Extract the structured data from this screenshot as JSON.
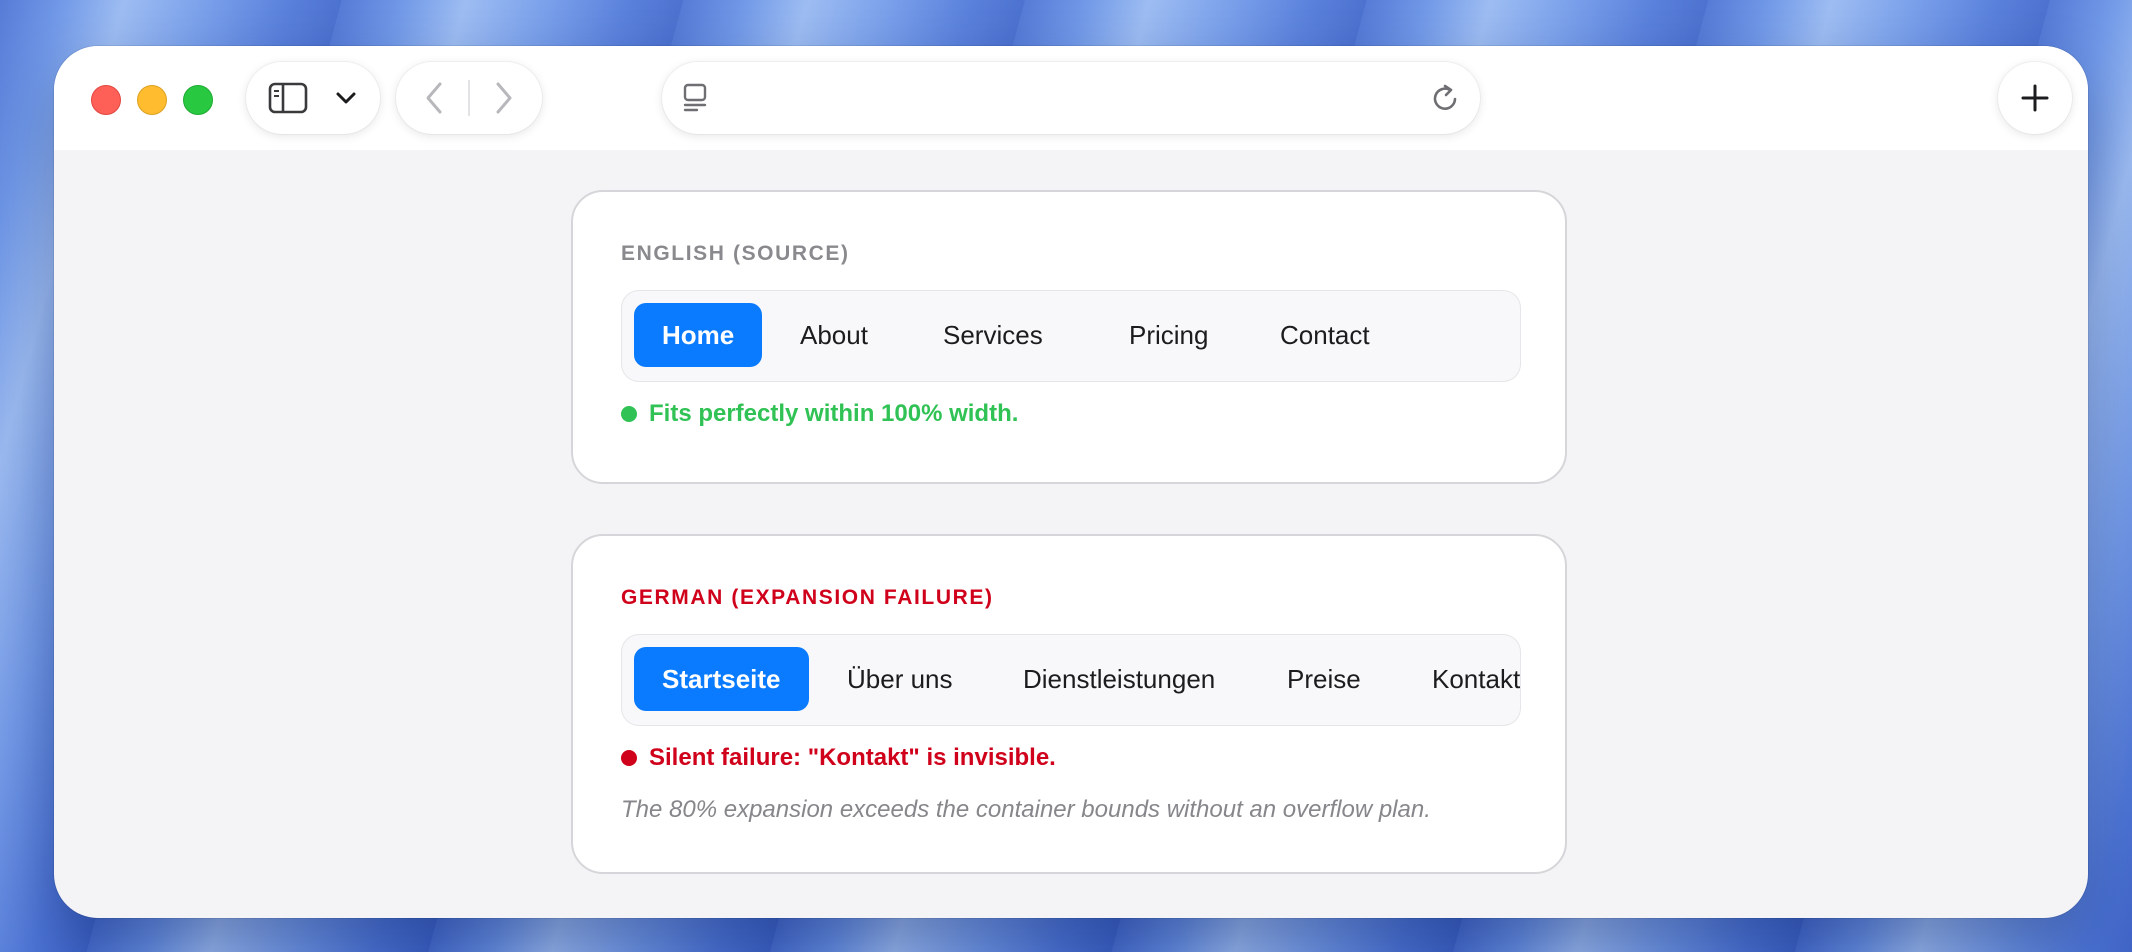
{
  "browser": {
    "address_text": "",
    "icons": {
      "sidebar": "sidebar-icon",
      "dropdown": "chevron-down-icon",
      "back": "chevron-left-icon",
      "forward": "chevron-right-icon",
      "reader": "reader-icon",
      "reload": "reload-icon",
      "new_tab": "plus-icon"
    }
  },
  "english_card": {
    "label": "ENGLISH (SOURCE)",
    "nav_items": [
      "Home",
      "About",
      "Services",
      "Pricing",
      "Contact"
    ],
    "active_index": 0,
    "status": "Fits perfectly within 100% width.",
    "status_color": "#30c254"
  },
  "german_card": {
    "label": "GERMAN (EXPANSION FAILURE)",
    "nav_items": [
      "Startseite",
      "Über uns",
      "Dienstleistungen",
      "Preise",
      "Kontakt"
    ],
    "active_index": 0,
    "status": "Silent failure: \"Kontakt\" is invisible.",
    "status_color": "#d0021b",
    "note": "The 80% expansion exceeds the container bounds without an overflow plan."
  },
  "colors": {
    "accent": "#0a7bff",
    "success": "#30c254",
    "error": "#d0021b"
  }
}
